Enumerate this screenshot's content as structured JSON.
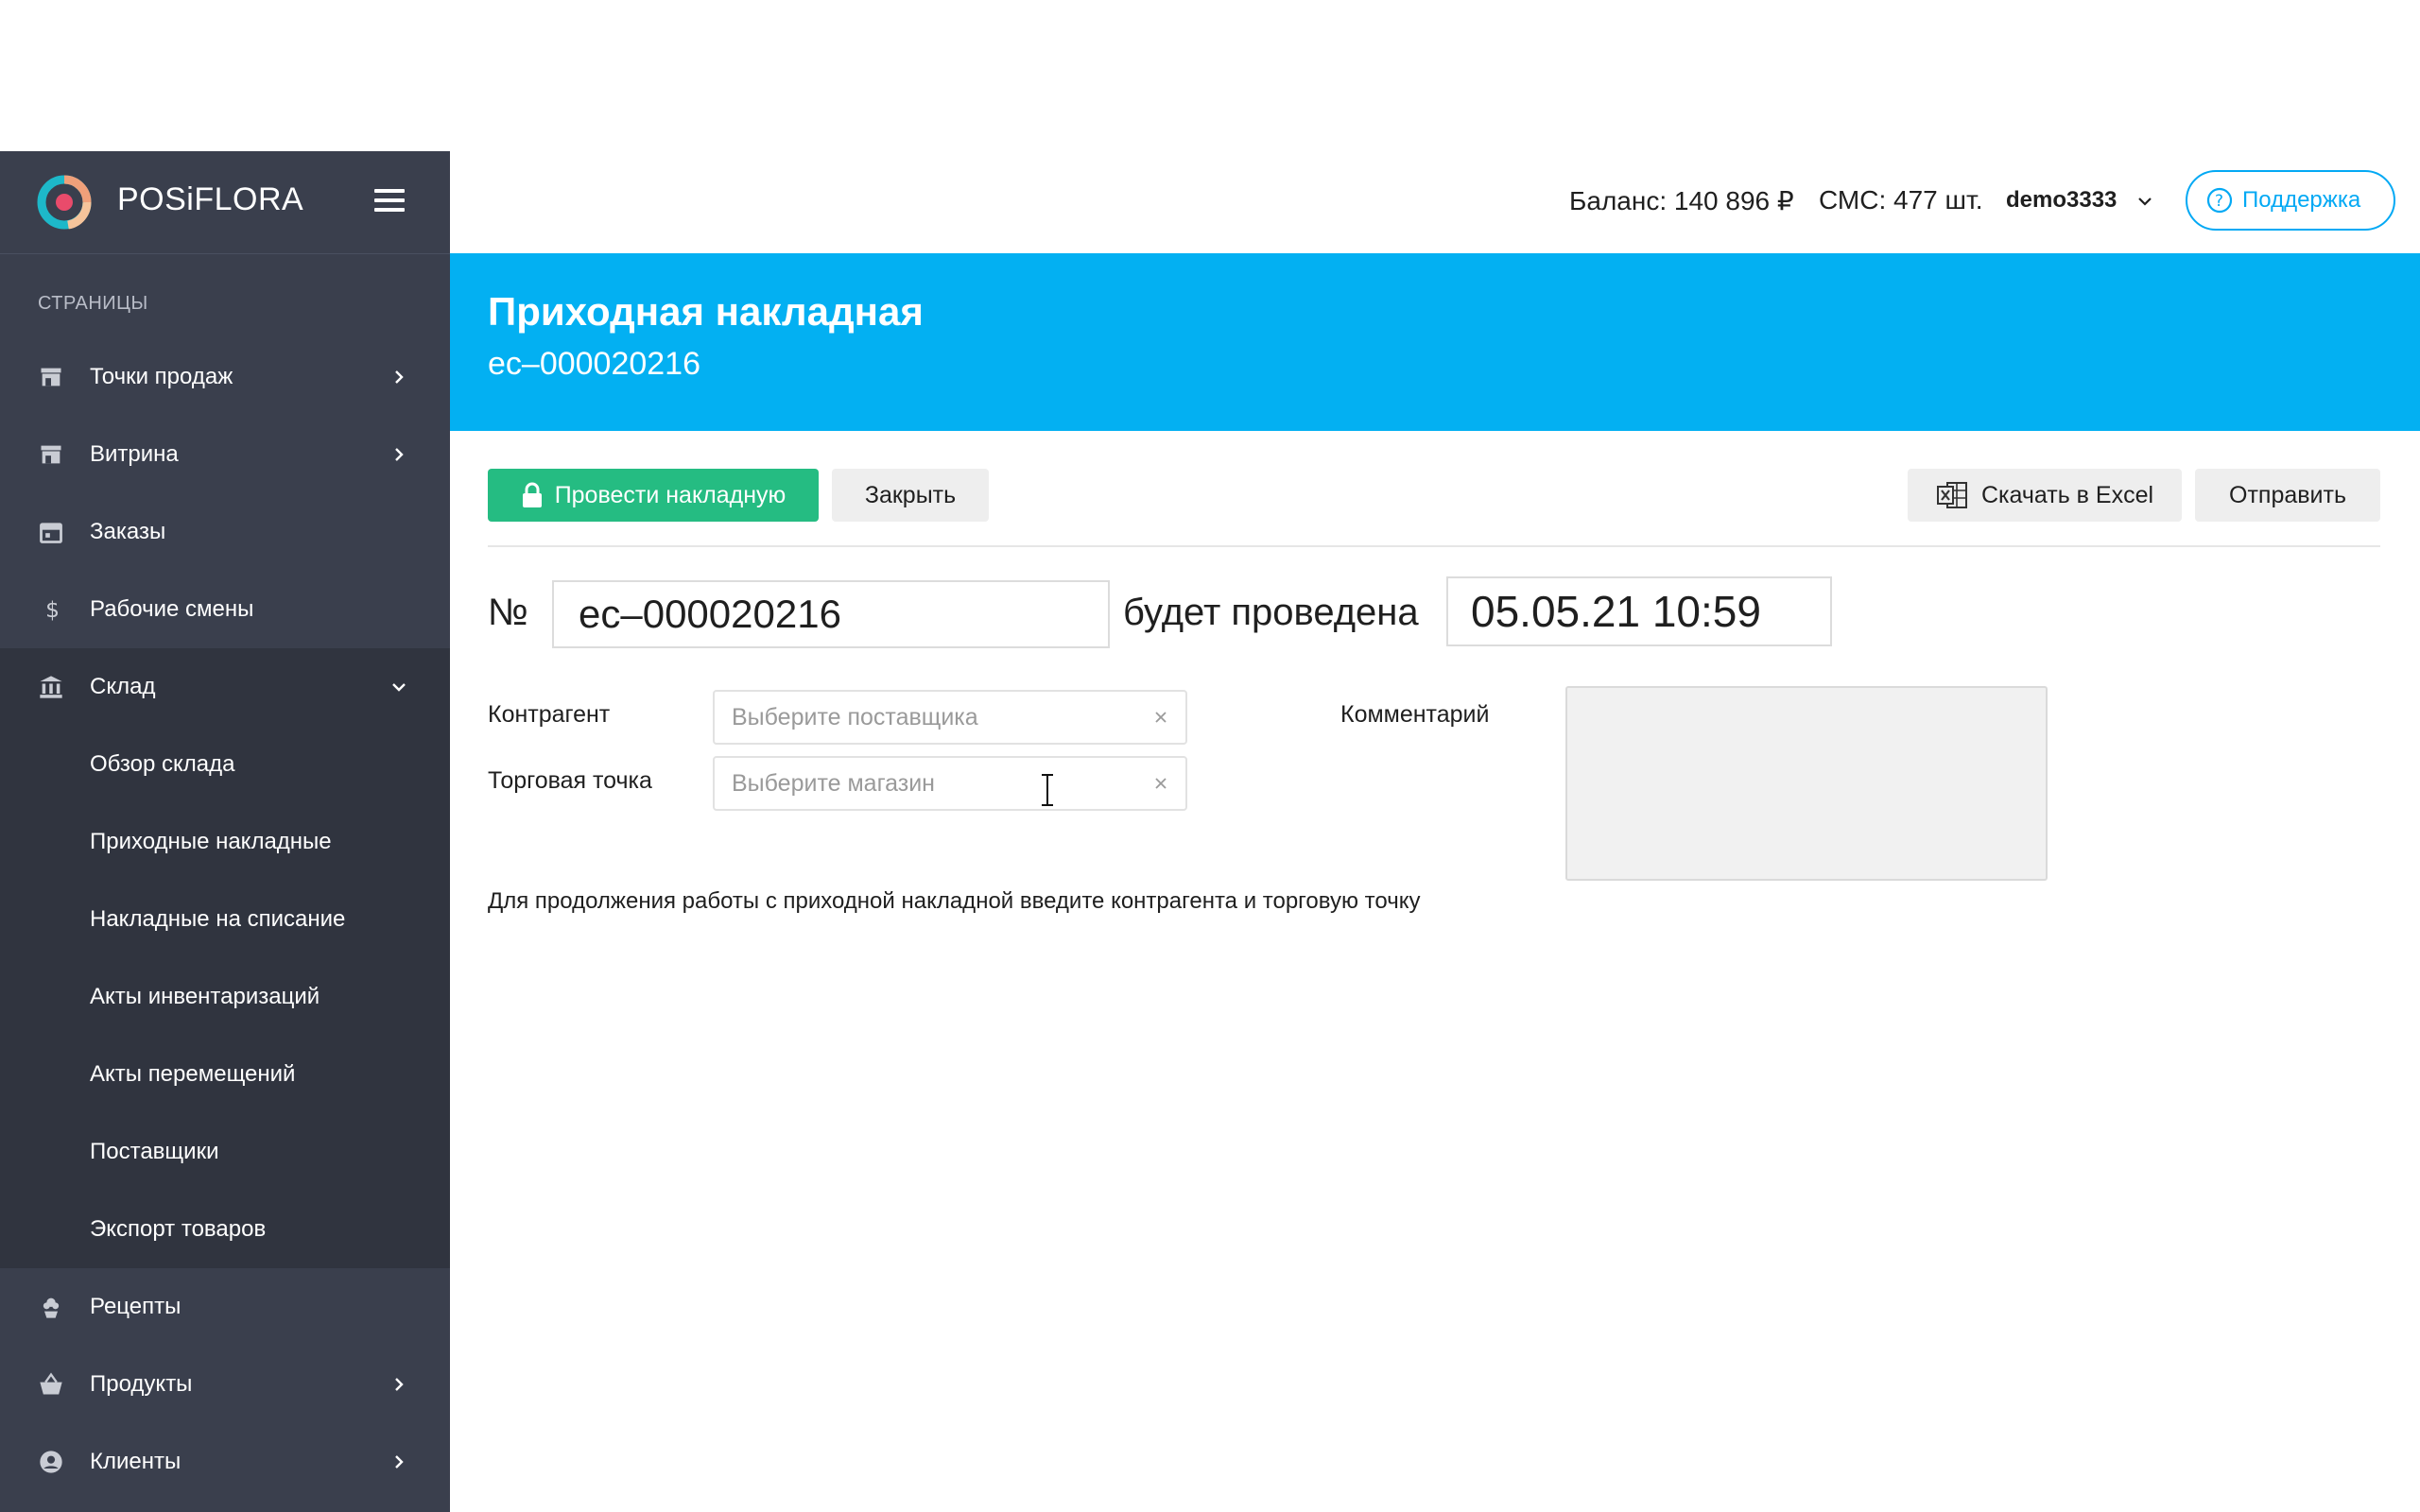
{
  "brand": {
    "name": "POSiFLORA"
  },
  "sidebar": {
    "section_title": "СТРАНИЦЫ",
    "items": [
      {
        "label": "Точки продаж",
        "icon": "store-icon",
        "chevron": "right"
      },
      {
        "label": "Витрина",
        "icon": "store-icon",
        "chevron": "right"
      },
      {
        "label": "Заказы",
        "icon": "calendar-icon",
        "chevron": ""
      },
      {
        "label": "Рабочие смены",
        "icon": "dollar-icon",
        "chevron": ""
      },
      {
        "label": "Склад",
        "icon": "bank-icon",
        "chevron": "down"
      }
    ],
    "warehouse_sub": [
      {
        "label": "Обзор склада"
      },
      {
        "label": "Приходные накладные"
      },
      {
        "label": "Накладные на списание"
      },
      {
        "label": "Акты инвентаризаций"
      },
      {
        "label": "Акты перемещений"
      },
      {
        "label": "Поставщики"
      },
      {
        "label": "Экспорт товаров"
      }
    ],
    "items_after": [
      {
        "label": "Рецепты",
        "icon": "flower-icon",
        "chevron": ""
      },
      {
        "label": "Продукты",
        "icon": "basket-icon",
        "chevron": "right"
      },
      {
        "label": "Клиенты",
        "icon": "user-icon",
        "chevron": "right"
      }
    ]
  },
  "topbar": {
    "balance": "Баланс: 140 896 ₽",
    "sms": "СМС: 477 шт.",
    "user": "demo3333",
    "support_label": "Поддержка"
  },
  "banner": {
    "title": "Приходная накладная",
    "subtitle": "ec–000020216"
  },
  "toolbar": {
    "post_label": "Провести накладную",
    "close_label": "Закрыть",
    "excel_label": "Скачать в Excel",
    "send_label": "Отправить"
  },
  "form": {
    "number_label": "№",
    "number_value": "ec–000020216",
    "will_be_posted_label": "будет проведена",
    "date_value": "05.05.21 10:59",
    "counterparty_label": "Контрагент",
    "counterparty_placeholder": "Выберите поставщика",
    "store_label": "Торговая точка",
    "store_placeholder": "Выберите магазин",
    "comment_label": "Комментарий",
    "hint": "Для продолжения работы с приходной накладной введите контрагента и торговую точку"
  },
  "colors": {
    "sidebar_bg": "#3a3f4d",
    "sidebar_sub_bg": "#30343f",
    "banner_bg": "#03b0f2",
    "primary_button": "#25bc82",
    "support_accent": "#03a9f4"
  }
}
